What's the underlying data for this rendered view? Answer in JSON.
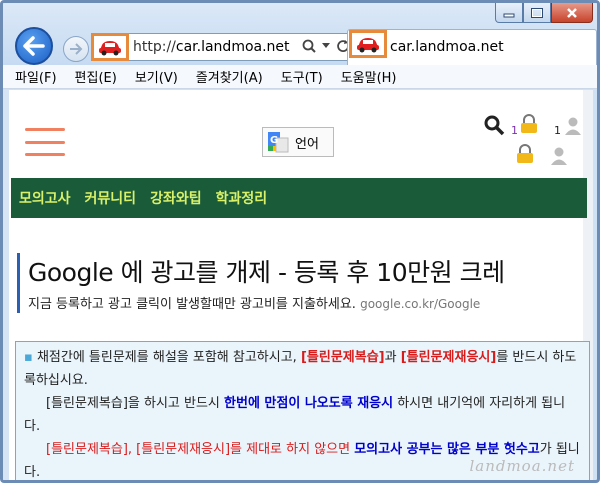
{
  "browser": {
    "url_prefix": "http://",
    "url_host": "car.landmoa.net",
    "tab_title": "car.landmoa.net",
    "colors": {
      "highlight": "#e88a3c",
      "back_button": "#1a5fc6"
    }
  },
  "menubar": {
    "items": [
      "파일(F)",
      "편집(E)",
      "보기(V)",
      "즐겨찾기(A)",
      "도구(T)",
      "도움말(H)"
    ]
  },
  "page": {
    "language_button": "언어",
    "user_counts": [
      "1",
      "1"
    ],
    "nav": [
      "모의고사",
      "커뮤니티",
      "강좌와팁",
      "학과정리"
    ],
    "ad": {
      "title": "Google 에 광고를 개제 - 등록 후 10만원 크레",
      "desc": "지금 등록하고 광고 클릭이 발생할때만 광고비를 지출하세요.",
      "source": "google.co.kr/Google"
    },
    "notice": {
      "p1_a": "채점간에 틀린문제를 해설을 포함해 참고하시고, ",
      "p1_b": "[틀린문제복습]",
      "p1_c": "과 ",
      "p1_d": "[틀린문제재응시]",
      "p1_e": "를 반드시 하도록하십시요.",
      "p2_a": "[틀린문제복습]을 하시고 반드시 ",
      "p2_b": "한번에 만점이 나오도록 재응시",
      "p2_c": " 하시면 내기억에 자리하게 됩니다.",
      "p3_a": "[틀린문제복습], [틀린문제재응시]를 제대로 하지 않으면 ",
      "p3_b": "모의고사 공부는 많은 부분 헛수고",
      "p3_c": "가 됩니다."
    },
    "watermark": "landmoa.net"
  }
}
